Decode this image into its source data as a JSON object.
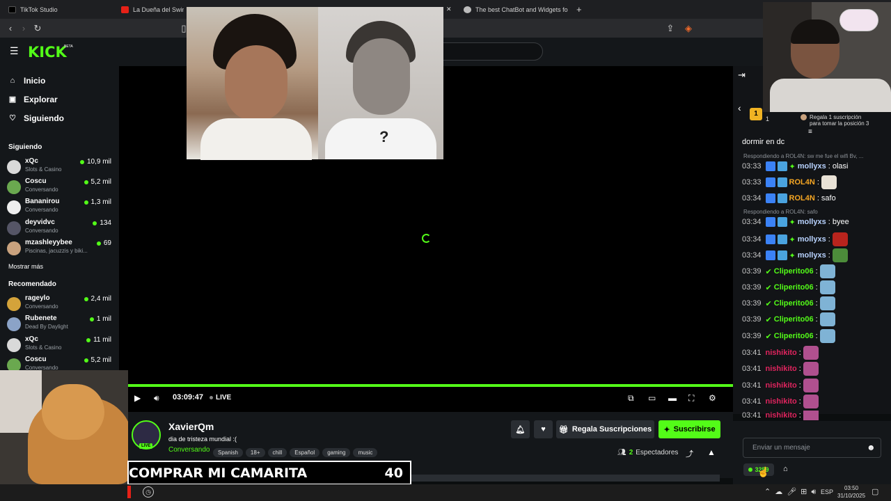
{
  "browser": {
    "tabs": [
      {
        "title": "TikTok Studio",
        "color": "#111111"
      },
      {
        "title": "La Dueña del Swing -",
        "color": "#e62117"
      },
      {
        "title": "The best ChatBot and Widgets for Ki",
        "color": "#cccccc"
      }
    ],
    "new_tab": "+",
    "close_tab": "✕"
  },
  "kick": {
    "logo": "KICK",
    "beta": "BETA",
    "accent": "#53fc18"
  },
  "sidebar": {
    "nav": [
      {
        "label": "Inicio",
        "icon": "home-icon",
        "glyph": "⌂"
      },
      {
        "label": "Explorar",
        "icon": "compass-icon",
        "glyph": "▣"
      },
      {
        "label": "Siguiendo",
        "icon": "heart-icon",
        "glyph": "♡"
      }
    ],
    "following_header": "Siguiendo",
    "following": [
      {
        "name": "xQc",
        "category": "Slots & Casino",
        "viewers": "10,9 mil",
        "color": "#d9d9d9"
      },
      {
        "name": "Coscu",
        "category": "Conversando",
        "viewers": "5,2 mil",
        "color": "#6aa84f"
      },
      {
        "name": "Bananirou",
        "category": "Conversando",
        "viewers": "1,3 mil",
        "color": "#eeeeee"
      },
      {
        "name": "deyvidvc",
        "category": "Conversando",
        "viewers": "134",
        "color": "#555566"
      },
      {
        "name": "mzashleyybee",
        "category": "Piscinas, jacuzzis y biki...",
        "viewers": "69",
        "color": "#c9a27e"
      }
    ],
    "show_more": "Mostrar más",
    "recommended_header": "Recomendado",
    "recommended": [
      {
        "name": "rageylo",
        "category": "Conversando",
        "viewers": "2,4 mil",
        "color": "#d4a33a"
      },
      {
        "name": "Rubenete",
        "category": "Dead By Daylight",
        "viewers": "1 mil",
        "color": "#8ba3c7"
      },
      {
        "name": "xQc",
        "category": "Slots & Casino",
        "viewers": "11 mil",
        "color": "#d9d9d9"
      },
      {
        "name": "Coscu",
        "category": "Conversando",
        "viewers": "5,2 mil",
        "color": "#6aa84f"
      }
    ]
  },
  "player": {
    "time": "03:09:47",
    "live_label": "LIVE",
    "overlay_question": "?"
  },
  "stream": {
    "channel": "XavierQm",
    "title": "dia de tristeza mundial :(",
    "category": "Conversando",
    "tags": [
      "Spanish",
      "18+",
      "chill",
      "Español",
      "gaming",
      "music"
    ],
    "avatar_live": "LIVE",
    "gift_subs": "Regala Suscripciones",
    "subscribe": "Suscribirse",
    "viewers_count": "2",
    "viewers_label": "Espectadores"
  },
  "banner": {
    "text": "COMPRAR MI CAMARITA",
    "number": "40"
  },
  "chat": {
    "rank_number": "1",
    "rank_count": "1",
    "gift_prompt_line1": "Regala 1 suscripción",
    "gift_prompt_line2": "para tomar la posición 3",
    "top_message": "dormir en dc",
    "reply1": "Respondiendo a ROL4N: sw me fue el wifi Bv, ...",
    "reply2": "Respondiendo a ROL4N: safo",
    "messages": [
      {
        "time": "03:33",
        "user": "mollyxs",
        "text": ": olasi",
        "color": "#b9d3ff"
      },
      {
        "time": "03:33",
        "user": "ROL4N",
        "text": ":",
        "color": "#f5a623"
      },
      {
        "time": "03:34",
        "user": "ROL4N",
        "text": ": safo",
        "color": "#f5a623"
      },
      {
        "time": "03:34",
        "user": "mollyxs",
        "text": ": byee",
        "color": "#b9d3ff"
      },
      {
        "time": "03:34",
        "user": "mollyxs",
        "text": ":",
        "color": "#b9d3ff"
      },
      {
        "time": "03:34",
        "user": "mollyxs",
        "text": ":",
        "color": "#b9d3ff"
      },
      {
        "time": "03:39",
        "user": "Cliperito06",
        "text": ":",
        "color": "#53fc18"
      },
      {
        "time": "03:39",
        "user": "Cliperito06",
        "text": ":",
        "color": "#53fc18"
      },
      {
        "time": "03:39",
        "user": "Cliperito06",
        "text": ":",
        "color": "#53fc18"
      },
      {
        "time": "03:39",
        "user": "Cliperito06",
        "text": ":",
        "color": "#53fc18"
      },
      {
        "time": "03:39",
        "user": "Cliperito06",
        "text": ":",
        "color": "#53fc18"
      },
      {
        "time": "03:41",
        "user": "nishikito",
        "text": ":",
        "color": "#e0245e"
      },
      {
        "time": "03:41",
        "user": "nishikito",
        "text": ":",
        "color": "#e0245e"
      },
      {
        "time": "03:41",
        "user": "nishikito",
        "text": ":",
        "color": "#e0245e"
      },
      {
        "time": "03:41",
        "user": "nishikito",
        "text": ":",
        "color": "#e0245e"
      },
      {
        "time": "03:41",
        "user": "nishikito",
        "text": ":",
        "color": "#e0245e"
      }
    ],
    "input_placeholder": "Enviar un mensaje",
    "points": "3259"
  },
  "taskbar": {
    "lang": "ESP",
    "time": "03:50",
    "date": "31/10/2025"
  }
}
